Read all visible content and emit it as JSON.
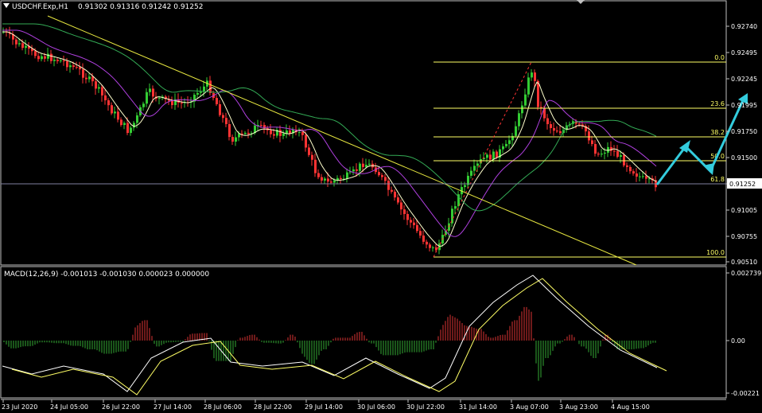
{
  "header": {
    "symbol_tf": "USDCHF.Exp,H1",
    "ohlc": "0.91302 0.91316 0.91242 0.91252"
  },
  "macd": {
    "title": "MACD(12,26,9) -0.001013 -0.001030 0.000023 0.000000",
    "ticks": [
      "0.002739",
      "0.00",
      "-0.00221"
    ]
  },
  "price_axis": {
    "ticks": [
      "0.92740",
      "0.92495",
      "0.92245",
      "0.91995",
      "0.91750",
      "0.91500",
      "0.91250",
      "0.91005",
      "0.90755",
      "0.90510"
    ],
    "current_price": "0.91252"
  },
  "time_axis": {
    "labels": [
      "23 Jul 2020",
      "24 Jul 05:00",
      "26 Jul 22:00",
      "27 Jul 14:00",
      "28 Jul 06:00",
      "28 Jul 22:00",
      "29 Jul 14:00",
      "30 Jul 06:00",
      "30 Jul 22:00",
      "31 Jul 14:00",
      "3 Aug 07:00",
      "3 Aug 23:00",
      "4 Aug 15:00"
    ]
  },
  "fibonacci": {
    "levels": [
      "0.0",
      "23.6",
      "38.2",
      "50.0",
      "61.8",
      "100.0"
    ]
  },
  "colors": {
    "background": "#000000",
    "bull": "#33cc33",
    "bear": "#ff3333",
    "fib": "#ffff66",
    "trendline": "#e8e840",
    "ma_fast": "#ffffcc",
    "ma_purple": "#b040e0",
    "ma_green": "#33aa55",
    "arrow": "#33ccdd",
    "axis": "#c0c0c0"
  }
}
